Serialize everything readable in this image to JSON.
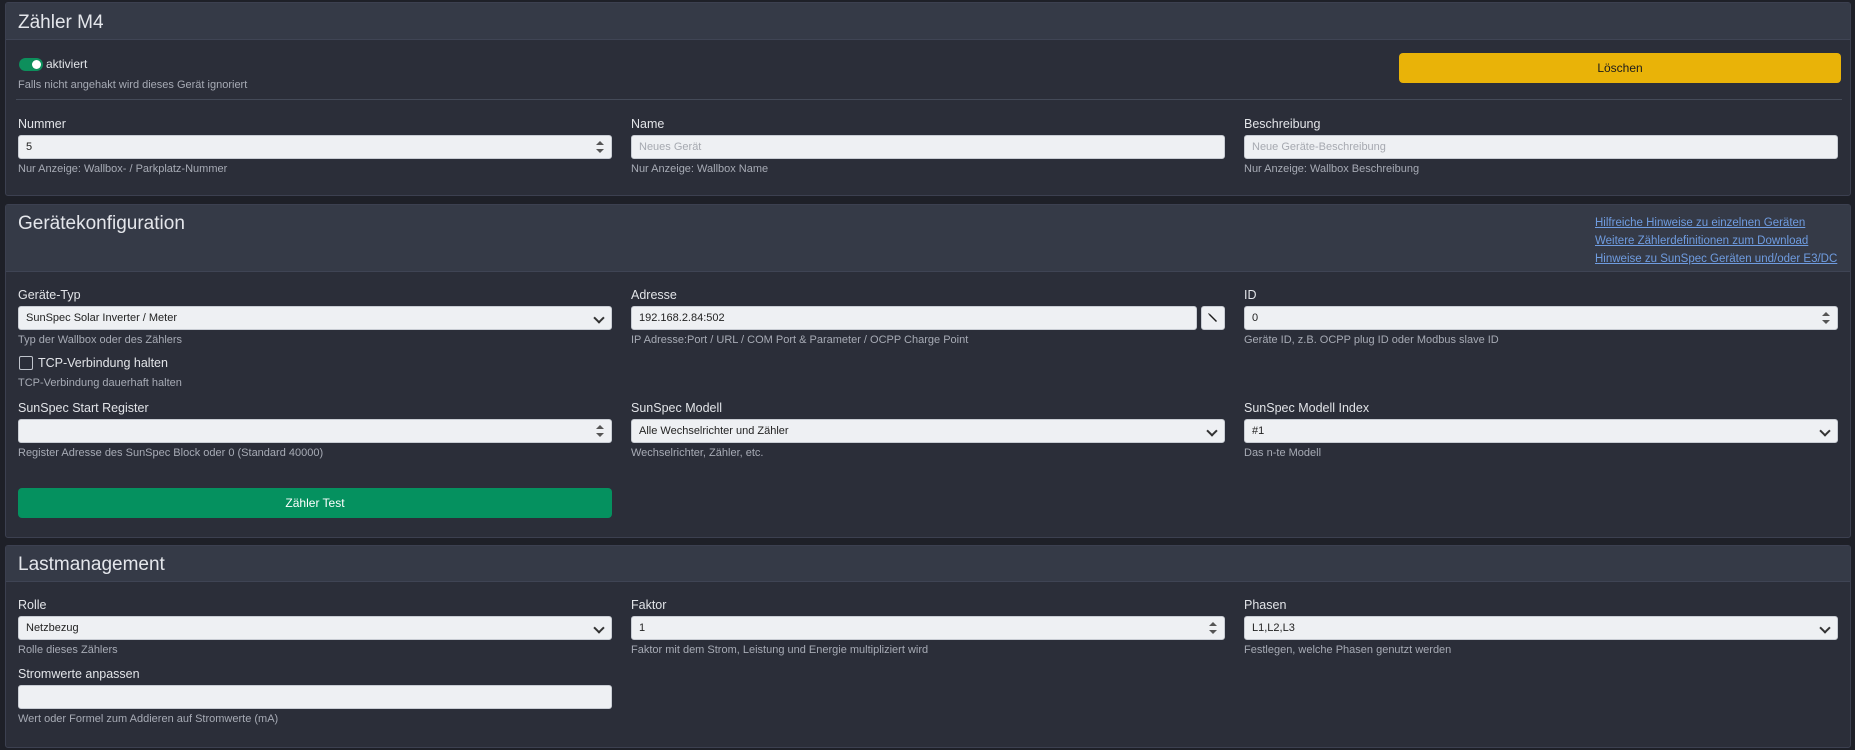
{
  "zaehler": {
    "title": "Zähler M4",
    "enabled_label": "aktiviert",
    "enabled_help": "Falls nicht angehakt wird dieses Gerät ignoriert",
    "delete_label": "Löschen",
    "nummer": {
      "label": "Nummer",
      "value": "5",
      "help": "Nur Anzeige: Wallbox- / Parkplatz-Nummer"
    },
    "name": {
      "label": "Name",
      "placeholder": "Neues Gerät",
      "help": "Nur Anzeige: Wallbox Name"
    },
    "beschreibung": {
      "label": "Beschreibung",
      "placeholder": "Neue Geräte-Beschreibung",
      "help": "Nur Anzeige: Wallbox Beschreibung"
    }
  },
  "config": {
    "title": "Gerätekonfiguration",
    "links": [
      "Hilfreiche Hinweise zu einzelnen Geräten",
      "Weitere Zählerdefinitionen zum Download",
      "Hinweise zu SunSpec Geräten und/oder E3/DC"
    ],
    "typ": {
      "label": "Geräte-Typ",
      "value": "SunSpec Solar Inverter / Meter",
      "help": "Typ der Wallbox oder des Zählers"
    },
    "adresse": {
      "label": "Adresse",
      "value": "192.168.2.84:502",
      "help": "IP Adresse:Port / URL / COM Port & Parameter / OCPP Charge Point",
      "edit_icon": "pencil-icon"
    },
    "id": {
      "label": "ID",
      "value": "0",
      "help": "Geräte ID, z.B. OCPP plug ID oder Modbus slave ID"
    },
    "tcp": {
      "label": "TCP-Verbindung halten",
      "help": "TCP-Verbindung dauerhaft halten"
    },
    "start_register": {
      "label": "SunSpec Start Register",
      "value": "",
      "help": "Register Adresse des SunSpec Block oder 0 (Standard 40000)"
    },
    "modell": {
      "label": "SunSpec Modell",
      "value": "Alle Wechselrichter und Zähler",
      "help": "Wechselrichter, Zähler, etc."
    },
    "modell_index": {
      "label": "SunSpec Modell Index",
      "value": "#1",
      "help": "Das n-te Modell"
    },
    "test_label": "Zähler Test"
  },
  "last": {
    "title": "Lastmanagement",
    "rolle": {
      "label": "Rolle",
      "value": "Netzbezug",
      "help": "Rolle dieses Zählers"
    },
    "faktor": {
      "label": "Faktor",
      "value": "1",
      "help": "Faktor mit dem Strom, Leistung und Energie multipliziert wird"
    },
    "phasen": {
      "label": "Phasen",
      "value": "L1,L2,L3",
      "help": "Festlegen, welche Phasen genutzt werden"
    },
    "stromwerte": {
      "label": "Stromwerte anpassen",
      "value": "",
      "help": "Wert oder Formel zum Addieren auf Stromwerte (mA)"
    }
  },
  "colors": {
    "accent_green": "#05915f",
    "accent_yellow": "#e9b308",
    "link": "#6f9ce0"
  }
}
